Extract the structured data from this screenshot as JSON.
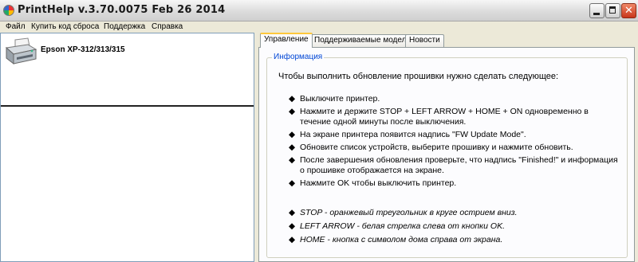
{
  "window": {
    "title": "PrintHelp v.3.70.0075 Feb 26 2014",
    "close_glyph": "✕"
  },
  "menu": [
    "Файл",
    "Купить код сброса",
    "Поддержка",
    "Справка"
  ],
  "devices": [
    {
      "label": "Epson XP-312/313/315",
      "icon": "printer-icon"
    }
  ],
  "tabs": [
    "Управление",
    "Поддерживаемые модели",
    "Новости"
  ],
  "panel": {
    "group_title": "Информация",
    "intro": "Чтобы выполнить обновление прошивки нужно сделать следующее:",
    "bullet": "◆",
    "steps": [
      "Выключите принтер.",
      "Нажмите и держите STOP + LEFT ARROW + HOME + ON одновременно в течение одной минуты после выключения.",
      "На экране принтера появится надпись \"FW Update Mode\".",
      "Обновите список устройств, выберите прошивку и нажмите обновить.",
      "После завершения обновления проверьте, что надпись \"Finished!\" и информация о прошивке отображается на экране.",
      "Нажмите OK чтобы выключить принтер."
    ],
    "notes": [
      "STOP - оранжевый треугольник в круге острием вниз.",
      "LEFT ARROW - белая стрелка слева от кнопки OK.",
      "HOME - кнопка с символом дома справа от экрана."
    ]
  }
}
